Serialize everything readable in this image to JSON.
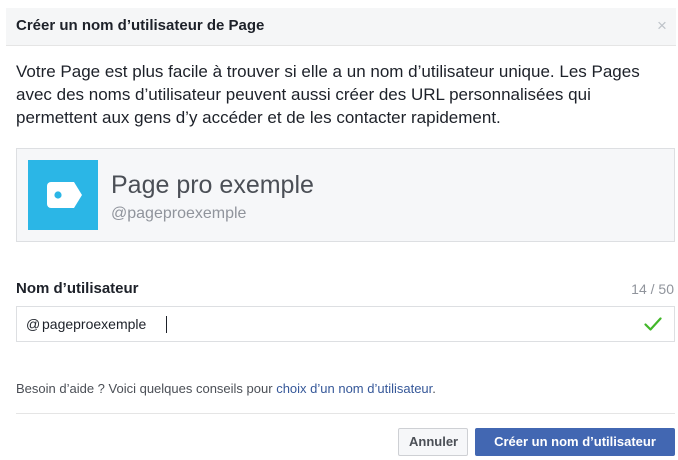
{
  "dialog": {
    "title": "Créer un nom d’utilisateur de Page",
    "close_glyph": "×"
  },
  "intro": "Votre Page est plus facile à trouver si elle a un nom d’utilisateur unique. Les Pages avec des noms d’utilisateur peuvent aussi créer des URL personnalisées qui permettent aux gens d’y accéder et de les contacter rapidement.",
  "preview": {
    "avatar_icon": "tag-icon",
    "avatar_color": "#2bb6e6",
    "page_name": "Page pro exemple",
    "handle": "@pageproexemple"
  },
  "username": {
    "label": "Nom d’utilisateur",
    "count": "14 / 50",
    "prefix": "@",
    "value": "pageproexemple",
    "valid_icon": "checkmark-icon",
    "valid_color": "#42b72a"
  },
  "help": {
    "text": "Besoin d’aide ? Voici quelques conseils pour",
    "link": "choix d’un nom d’utilisateur",
    "suffix": "."
  },
  "buttons": {
    "cancel": "Annuler",
    "create": "Créer un nom d’utilisateur"
  },
  "colors": {
    "primary": "#4267b2",
    "link": "#365899"
  }
}
